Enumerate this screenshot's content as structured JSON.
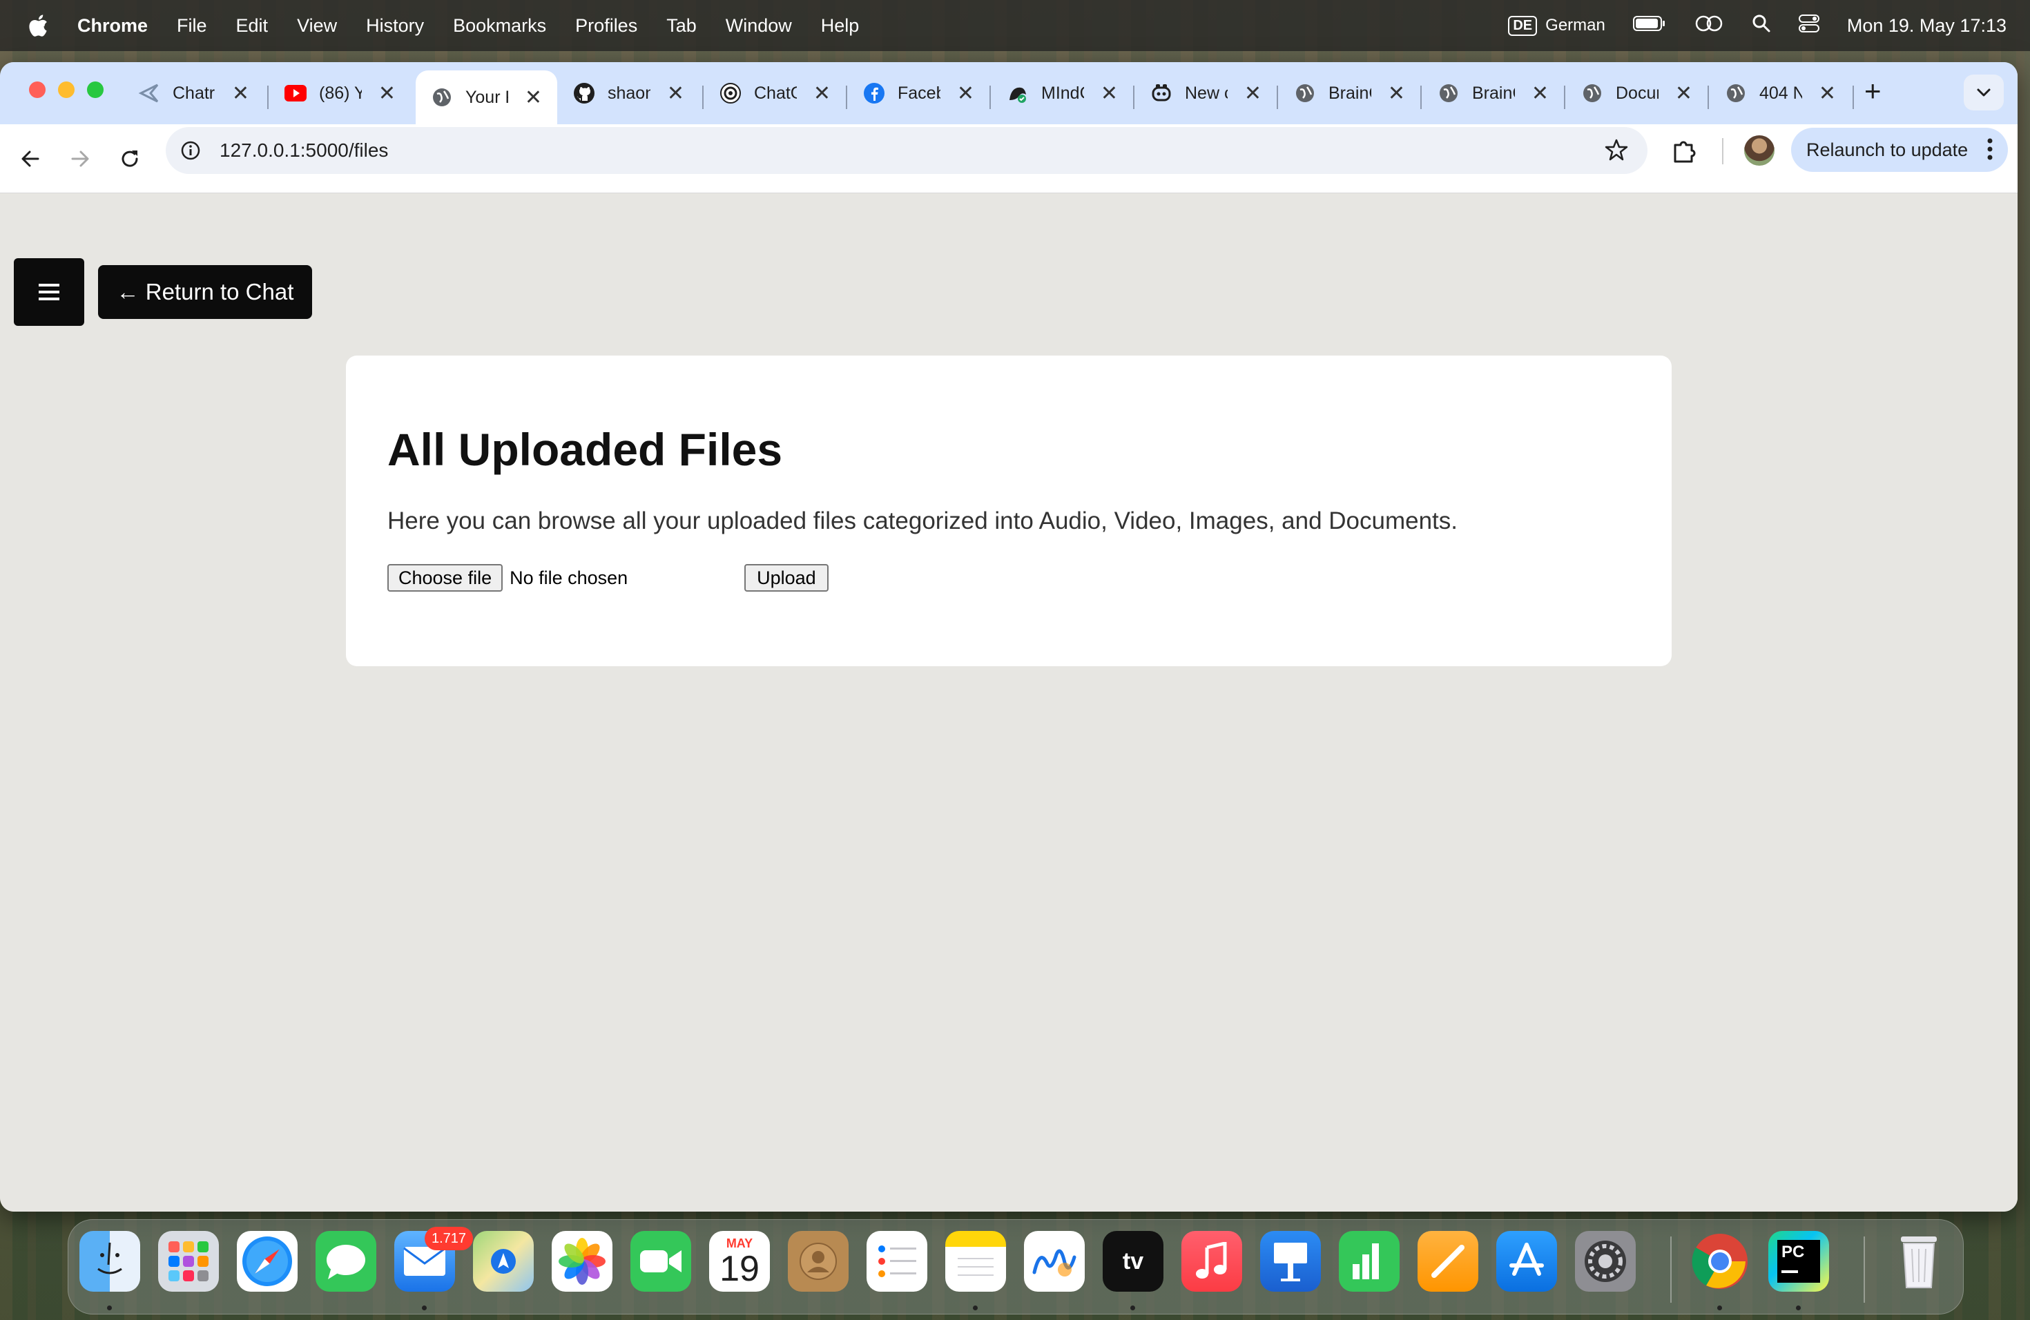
{
  "menubar": {
    "app_name": "Chrome",
    "items": [
      "File",
      "Edit",
      "View",
      "History",
      "Bookmarks",
      "Profiles",
      "Tab",
      "Window",
      "Help"
    ],
    "input_source_badge": "DE",
    "input_source_label": "German",
    "clock": "Mon 19. May  17:13"
  },
  "tabs": [
    {
      "title": "Chatr",
      "icon": "chatroom-icon"
    },
    {
      "title": "(86) Y",
      "icon": "youtube-icon"
    },
    {
      "title": "Your F",
      "icon": "globe-icon",
      "active": true
    },
    {
      "title": "shaon",
      "icon": "github-icon"
    },
    {
      "title": "ChatG",
      "icon": "openai-icon"
    },
    {
      "title": "Faceb",
      "icon": "facebook-icon"
    },
    {
      "title": "MIndC",
      "icon": "mindcraft-icon"
    },
    {
      "title": "New c",
      "icon": "copilot-icon"
    },
    {
      "title": "BrainC",
      "icon": "globe-icon"
    },
    {
      "title": "BrainC",
      "icon": "globe-icon"
    },
    {
      "title": "Docur",
      "icon": "globe-icon"
    },
    {
      "title": "404 N",
      "icon": "globe-icon"
    }
  ],
  "toolbar": {
    "url": "127.0.0.1:5000/files",
    "relaunch_label": "Relaunch to update"
  },
  "page": {
    "return_label": "← Return to Chat",
    "heading": "All Uploaded Files",
    "description": "Here you can browse all your uploaded files categorized into Audio, Video, Images, and Documents.",
    "choose_file_label": "Choose file",
    "no_file_label": "No file chosen",
    "upload_label": "Upload"
  },
  "dock": {
    "mail_badge": "1.717",
    "calendar_month": "MAY",
    "calendar_day": "19",
    "apps": [
      "finder-icon",
      "launchpad-icon",
      "safari-icon",
      "messages-icon",
      "mail-icon",
      "maps-icon",
      "photos-icon",
      "facetime-icon",
      "calendar-icon",
      "contacts-icon",
      "reminders-icon",
      "notes-icon",
      "freeform-icon",
      "appletv-icon",
      "music-icon",
      "keynote-icon",
      "numbers-icon",
      "pages-icon",
      "appstore-icon",
      "system-settings-icon",
      "chrome-icon",
      "pycharm-icon",
      "trash-icon"
    ]
  },
  "colors": {
    "tabstrip": "#d3e3fd",
    "page_background": "#e7e6e2",
    "button_dark": "#0c0c0c"
  }
}
